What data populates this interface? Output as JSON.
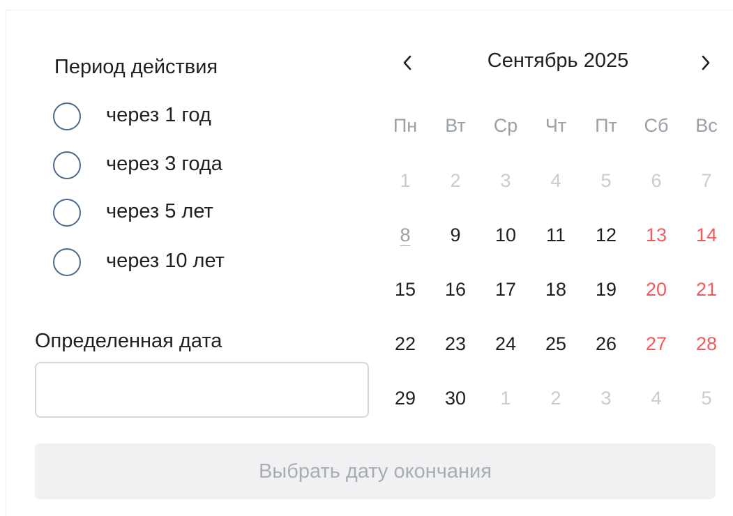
{
  "period": {
    "title": "Период действия",
    "options": [
      {
        "label": "через 1 год",
        "selected": false
      },
      {
        "label": "через 3 года",
        "selected": false
      },
      {
        "label": "через 5 лет",
        "selected": false
      },
      {
        "label": "через 10 лет",
        "selected": false
      }
    ]
  },
  "specific_date": {
    "label": "Определенная дата",
    "value": "",
    "placeholder": ""
  },
  "calendar": {
    "month_title": "Сентябрь 2025",
    "prev_icon": "chevron-left-icon",
    "next_icon": "chevron-right-icon",
    "weekdays": [
      "Пн",
      "Вт",
      "Ср",
      "Чт",
      "Пт",
      "Сб",
      "Вс"
    ],
    "weeks": [
      [
        {
          "d": "1",
          "muted": true
        },
        {
          "d": "2",
          "muted": true
        },
        {
          "d": "3",
          "muted": true
        },
        {
          "d": "4",
          "muted": true
        },
        {
          "d": "5",
          "muted": true
        },
        {
          "d": "6",
          "muted": true
        },
        {
          "d": "7",
          "muted": true
        }
      ],
      [
        {
          "d": "8",
          "today": true
        },
        {
          "d": "9"
        },
        {
          "d": "10"
        },
        {
          "d": "11"
        },
        {
          "d": "12"
        },
        {
          "d": "13",
          "weekend": true
        },
        {
          "d": "14",
          "weekend": true
        }
      ],
      [
        {
          "d": "15"
        },
        {
          "d": "16"
        },
        {
          "d": "17"
        },
        {
          "d": "18"
        },
        {
          "d": "19"
        },
        {
          "d": "20",
          "weekend": true
        },
        {
          "d": "21",
          "weekend": true
        }
      ],
      [
        {
          "d": "22"
        },
        {
          "d": "23"
        },
        {
          "d": "24"
        },
        {
          "d": "25"
        },
        {
          "d": "26"
        },
        {
          "d": "27",
          "weekend": true
        },
        {
          "d": "28",
          "weekend": true
        }
      ],
      [
        {
          "d": "29"
        },
        {
          "d": "30"
        },
        {
          "d": "1",
          "muted": true
        },
        {
          "d": "2",
          "muted": true
        },
        {
          "d": "3",
          "muted": true
        },
        {
          "d": "4",
          "muted": true
        },
        {
          "d": "5",
          "muted": true
        }
      ]
    ],
    "colors": {
      "weekend": "#f05b5b",
      "muted": "#c8cbd0",
      "weekday_header": "#9aa0a6"
    }
  },
  "submit": {
    "label": "Выбрать дату окончания",
    "disabled": true
  }
}
